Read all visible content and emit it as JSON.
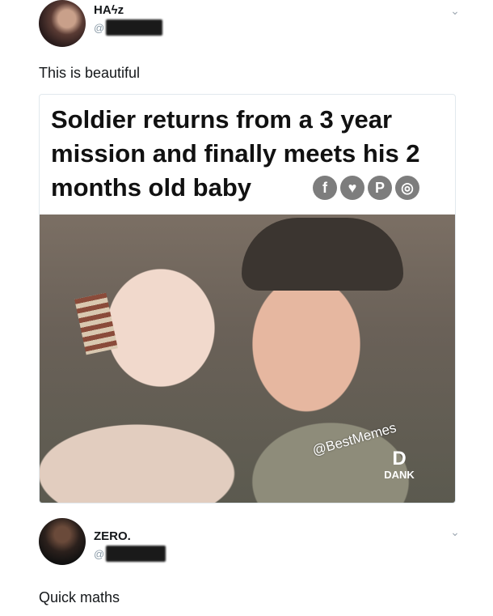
{
  "tweets": [
    {
      "display_name": "HAϟz",
      "handle_prefix": "@",
      "text": "This is beautiful",
      "media": {
        "headline": "Soldier returns from a 3 year mission and finally meets his 2 months old baby",
        "share_icons": [
          "f",
          "♥",
          "P",
          "◎"
        ],
        "watermark": "@BestMemes",
        "logo_text": "DANK"
      }
    },
    {
      "display_name": "ZERO.",
      "handle_prefix": "@",
      "text": "Quick maths"
    }
  ],
  "icons": {
    "chevron": "chevron-down-icon",
    "share": [
      "facebook-icon",
      "twitter-icon",
      "pinterest-icon",
      "instagram-icon"
    ]
  },
  "colors": {
    "text": "#14171a",
    "muted": "#8899a6",
    "share_icon_bg": "#7d7d7d"
  }
}
